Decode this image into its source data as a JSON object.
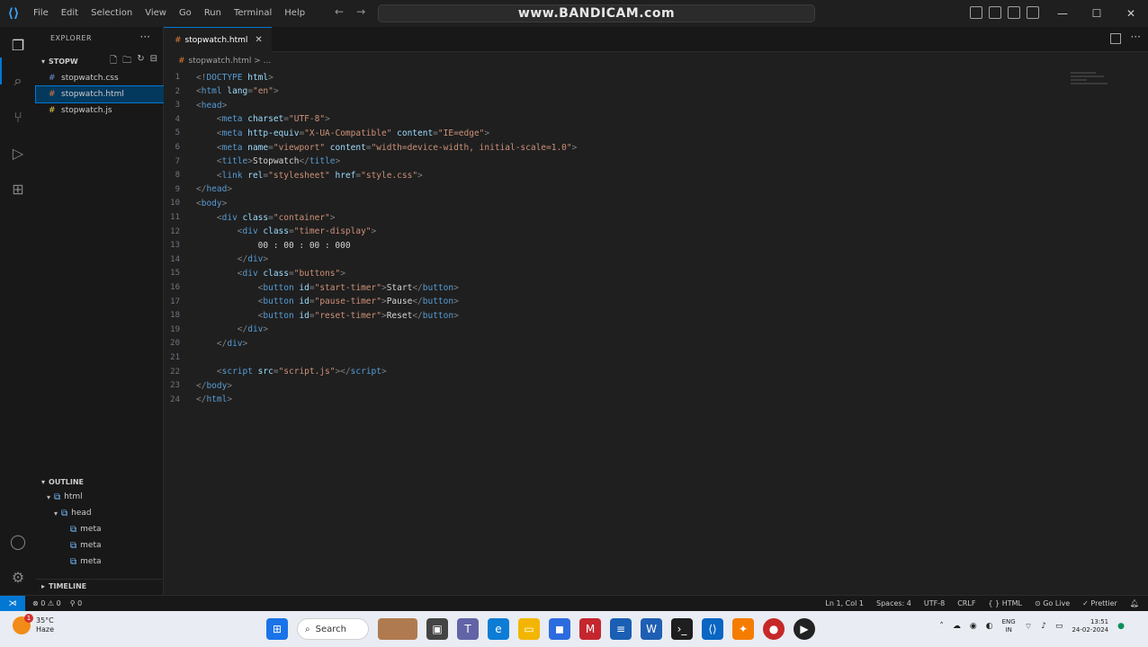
{
  "window": {
    "watermark": "www.BANDICAM.com",
    "menu": [
      "File",
      "Edit",
      "Selection",
      "View",
      "Go",
      "Run",
      "Terminal",
      "Help"
    ],
    "back_arrow": "←",
    "forward_arrow": "→",
    "minimize": "—",
    "maximize": "☐",
    "close": "✕"
  },
  "sidebar": {
    "header": "EXPLORER",
    "folder": "STOPW",
    "files": [
      {
        "name": "stopwatch.css",
        "icon": "#"
      },
      {
        "name": "stopwatch.html",
        "icon": "#"
      },
      {
        "name": "stopwatch.js",
        "icon": "#"
      }
    ],
    "outline_header": "OUTLINE",
    "outline_items": [
      "html",
      "head",
      "meta",
      "meta",
      "meta"
    ],
    "timeline_header": "TIMELINE"
  },
  "editor": {
    "tab_label": "stopwatch.html",
    "breadcrumb": "stopwatch.html > ...",
    "lines": [
      {
        "n": "1",
        "parts": [
          [
            "punct",
            "<!"
          ],
          [
            "tag",
            "DOCTYPE"
          ],
          [
            "attr",
            " html"
          ],
          [
            "punct",
            ">"
          ]
        ]
      },
      {
        "n": "2",
        "parts": [
          [
            "punct",
            "<"
          ],
          [
            "tag",
            "html"
          ],
          [
            "attr",
            " lang"
          ],
          [
            "punct",
            "="
          ],
          [
            "str",
            "\"en\""
          ],
          [
            "punct",
            ">"
          ]
        ]
      },
      {
        "n": "3",
        "parts": [
          [
            "punct",
            "<"
          ],
          [
            "tag",
            "head"
          ],
          [
            "punct",
            ">"
          ]
        ]
      },
      {
        "n": "4",
        "parts": [
          [
            "txt",
            "    "
          ],
          [
            "punct",
            "<"
          ],
          [
            "tag",
            "meta"
          ],
          [
            "attr",
            " charset"
          ],
          [
            "punct",
            "="
          ],
          [
            "str",
            "\"UTF-8\""
          ],
          [
            "punct",
            ">"
          ]
        ]
      },
      {
        "n": "5",
        "parts": [
          [
            "txt",
            "    "
          ],
          [
            "punct",
            "<"
          ],
          [
            "tag",
            "meta"
          ],
          [
            "attr",
            " http-equiv"
          ],
          [
            "punct",
            "="
          ],
          [
            "str",
            "\"X-UA-Compatible\""
          ],
          [
            "attr",
            " content"
          ],
          [
            "punct",
            "="
          ],
          [
            "str",
            "\"IE=edge\""
          ],
          [
            "punct",
            ">"
          ]
        ]
      },
      {
        "n": "6",
        "parts": [
          [
            "txt",
            "    "
          ],
          [
            "punct",
            "<"
          ],
          [
            "tag",
            "meta"
          ],
          [
            "attr",
            " name"
          ],
          [
            "punct",
            "="
          ],
          [
            "str",
            "\"viewport\""
          ],
          [
            "attr",
            " content"
          ],
          [
            "punct",
            "="
          ],
          [
            "str",
            "\"width=device-width, initial-scale=1.0\""
          ],
          [
            "punct",
            ">"
          ]
        ]
      },
      {
        "n": "7",
        "parts": [
          [
            "txt",
            "    "
          ],
          [
            "punct",
            "<"
          ],
          [
            "tag",
            "title"
          ],
          [
            "punct",
            ">"
          ],
          [
            "txt",
            "Stopwatch"
          ],
          [
            "punct",
            "</"
          ],
          [
            "tag",
            "title"
          ],
          [
            "punct",
            ">"
          ]
        ]
      },
      {
        "n": "8",
        "parts": [
          [
            "txt",
            "    "
          ],
          [
            "punct",
            "<"
          ],
          [
            "tag",
            "link"
          ],
          [
            "attr",
            " rel"
          ],
          [
            "punct",
            "="
          ],
          [
            "str",
            "\"stylesheet\""
          ],
          [
            "attr",
            " href"
          ],
          [
            "punct",
            "="
          ],
          [
            "str",
            "\"style.css\""
          ],
          [
            "punct",
            ">"
          ]
        ]
      },
      {
        "n": "9",
        "parts": [
          [
            "punct",
            "</"
          ],
          [
            "tag",
            "head"
          ],
          [
            "punct",
            ">"
          ]
        ]
      },
      {
        "n": "10",
        "parts": [
          [
            "punct",
            "<"
          ],
          [
            "tag",
            "body"
          ],
          [
            "punct",
            ">"
          ]
        ]
      },
      {
        "n": "11",
        "parts": [
          [
            "txt",
            "    "
          ],
          [
            "punct",
            "<"
          ],
          [
            "tag",
            "div"
          ],
          [
            "attr",
            " class"
          ],
          [
            "punct",
            "="
          ],
          [
            "str",
            "\"container\""
          ],
          [
            "punct",
            ">"
          ]
        ]
      },
      {
        "n": "12",
        "parts": [
          [
            "txt",
            "        "
          ],
          [
            "punct",
            "<"
          ],
          [
            "tag",
            "div"
          ],
          [
            "attr",
            " class"
          ],
          [
            "punct",
            "="
          ],
          [
            "str",
            "\"timer-display\""
          ],
          [
            "punct",
            ">"
          ]
        ]
      },
      {
        "n": "13",
        "parts": [
          [
            "txt",
            "            00 : 00 : 00 : 000"
          ]
        ]
      },
      {
        "n": "14",
        "parts": [
          [
            "txt",
            "        "
          ],
          [
            "punct",
            "</"
          ],
          [
            "tag",
            "div"
          ],
          [
            "punct",
            ">"
          ]
        ]
      },
      {
        "n": "15",
        "parts": [
          [
            "txt",
            "        "
          ],
          [
            "punct",
            "<"
          ],
          [
            "tag",
            "div"
          ],
          [
            "attr",
            " class"
          ],
          [
            "punct",
            "="
          ],
          [
            "str",
            "\"buttons\""
          ],
          [
            "punct",
            ">"
          ]
        ]
      },
      {
        "n": "16",
        "parts": [
          [
            "txt",
            "            "
          ],
          [
            "punct",
            "<"
          ],
          [
            "tag",
            "button"
          ],
          [
            "attr",
            " id"
          ],
          [
            "punct",
            "="
          ],
          [
            "str",
            "\"start-timer\""
          ],
          [
            "punct",
            ">"
          ],
          [
            "txt",
            "Start"
          ],
          [
            "punct",
            "</"
          ],
          [
            "tag",
            "button"
          ],
          [
            "punct",
            ">"
          ]
        ]
      },
      {
        "n": "17",
        "parts": [
          [
            "txt",
            "            "
          ],
          [
            "punct",
            "<"
          ],
          [
            "tag",
            "button"
          ],
          [
            "attr",
            " id"
          ],
          [
            "punct",
            "="
          ],
          [
            "str",
            "\"pause-timer\""
          ],
          [
            "punct",
            ">"
          ],
          [
            "txt",
            "Pause"
          ],
          [
            "punct",
            "</"
          ],
          [
            "tag",
            "button"
          ],
          [
            "punct",
            ">"
          ]
        ]
      },
      {
        "n": "18",
        "parts": [
          [
            "txt",
            "            "
          ],
          [
            "punct",
            "<"
          ],
          [
            "tag",
            "button"
          ],
          [
            "attr",
            " id"
          ],
          [
            "punct",
            "="
          ],
          [
            "str",
            "\"reset-timer\""
          ],
          [
            "punct",
            ">"
          ],
          [
            "txt",
            "Reset"
          ],
          [
            "punct",
            "</"
          ],
          [
            "tag",
            "button"
          ],
          [
            "punct",
            ">"
          ]
        ]
      },
      {
        "n": "19",
        "parts": [
          [
            "txt",
            "        "
          ],
          [
            "punct",
            "</"
          ],
          [
            "tag",
            "div"
          ],
          [
            "punct",
            ">"
          ]
        ]
      },
      {
        "n": "20",
        "parts": [
          [
            "txt",
            "    "
          ],
          [
            "punct",
            "</"
          ],
          [
            "tag",
            "div"
          ],
          [
            "punct",
            ">"
          ]
        ]
      },
      {
        "n": "21",
        "parts": []
      },
      {
        "n": "22",
        "parts": [
          [
            "txt",
            "    "
          ],
          [
            "punct",
            "<"
          ],
          [
            "tag",
            "script"
          ],
          [
            "attr",
            " src"
          ],
          [
            "punct",
            "="
          ],
          [
            "str",
            "\"script.js\""
          ],
          [
            "punct",
            "></"
          ],
          [
            "tag",
            "script"
          ],
          [
            "punct",
            ">"
          ]
        ]
      },
      {
        "n": "23",
        "parts": [
          [
            "punct",
            "</"
          ],
          [
            "tag",
            "body"
          ],
          [
            "punct",
            ">"
          ]
        ]
      },
      {
        "n": "24",
        "parts": [
          [
            "punct",
            "</"
          ],
          [
            "tag",
            "html"
          ],
          [
            "punct",
            ">"
          ]
        ]
      }
    ]
  },
  "statusbar": {
    "problems": "⊗ 0 ⚠ 0",
    "ports": "⚲ 0",
    "position": "Ln 1, Col 1",
    "spaces": "Spaces: 4",
    "encoding": "UTF-8",
    "eol": "CRLF",
    "language": "{ } HTML",
    "golive": "⊙ Go Live",
    "prettier": "✓ Prettier"
  },
  "taskbar": {
    "temperature": "35°C",
    "weather": "Haze",
    "weather_badge": "1",
    "search_label": "Search",
    "lang_line1": "ENG",
    "lang_line2": "IN",
    "time": "13:51",
    "date": "24-02-2024"
  },
  "colors": {
    "accent": "#0078d4",
    "tag": "#569cd6",
    "attribute": "#9cdcfe",
    "string": "#ce9178"
  }
}
